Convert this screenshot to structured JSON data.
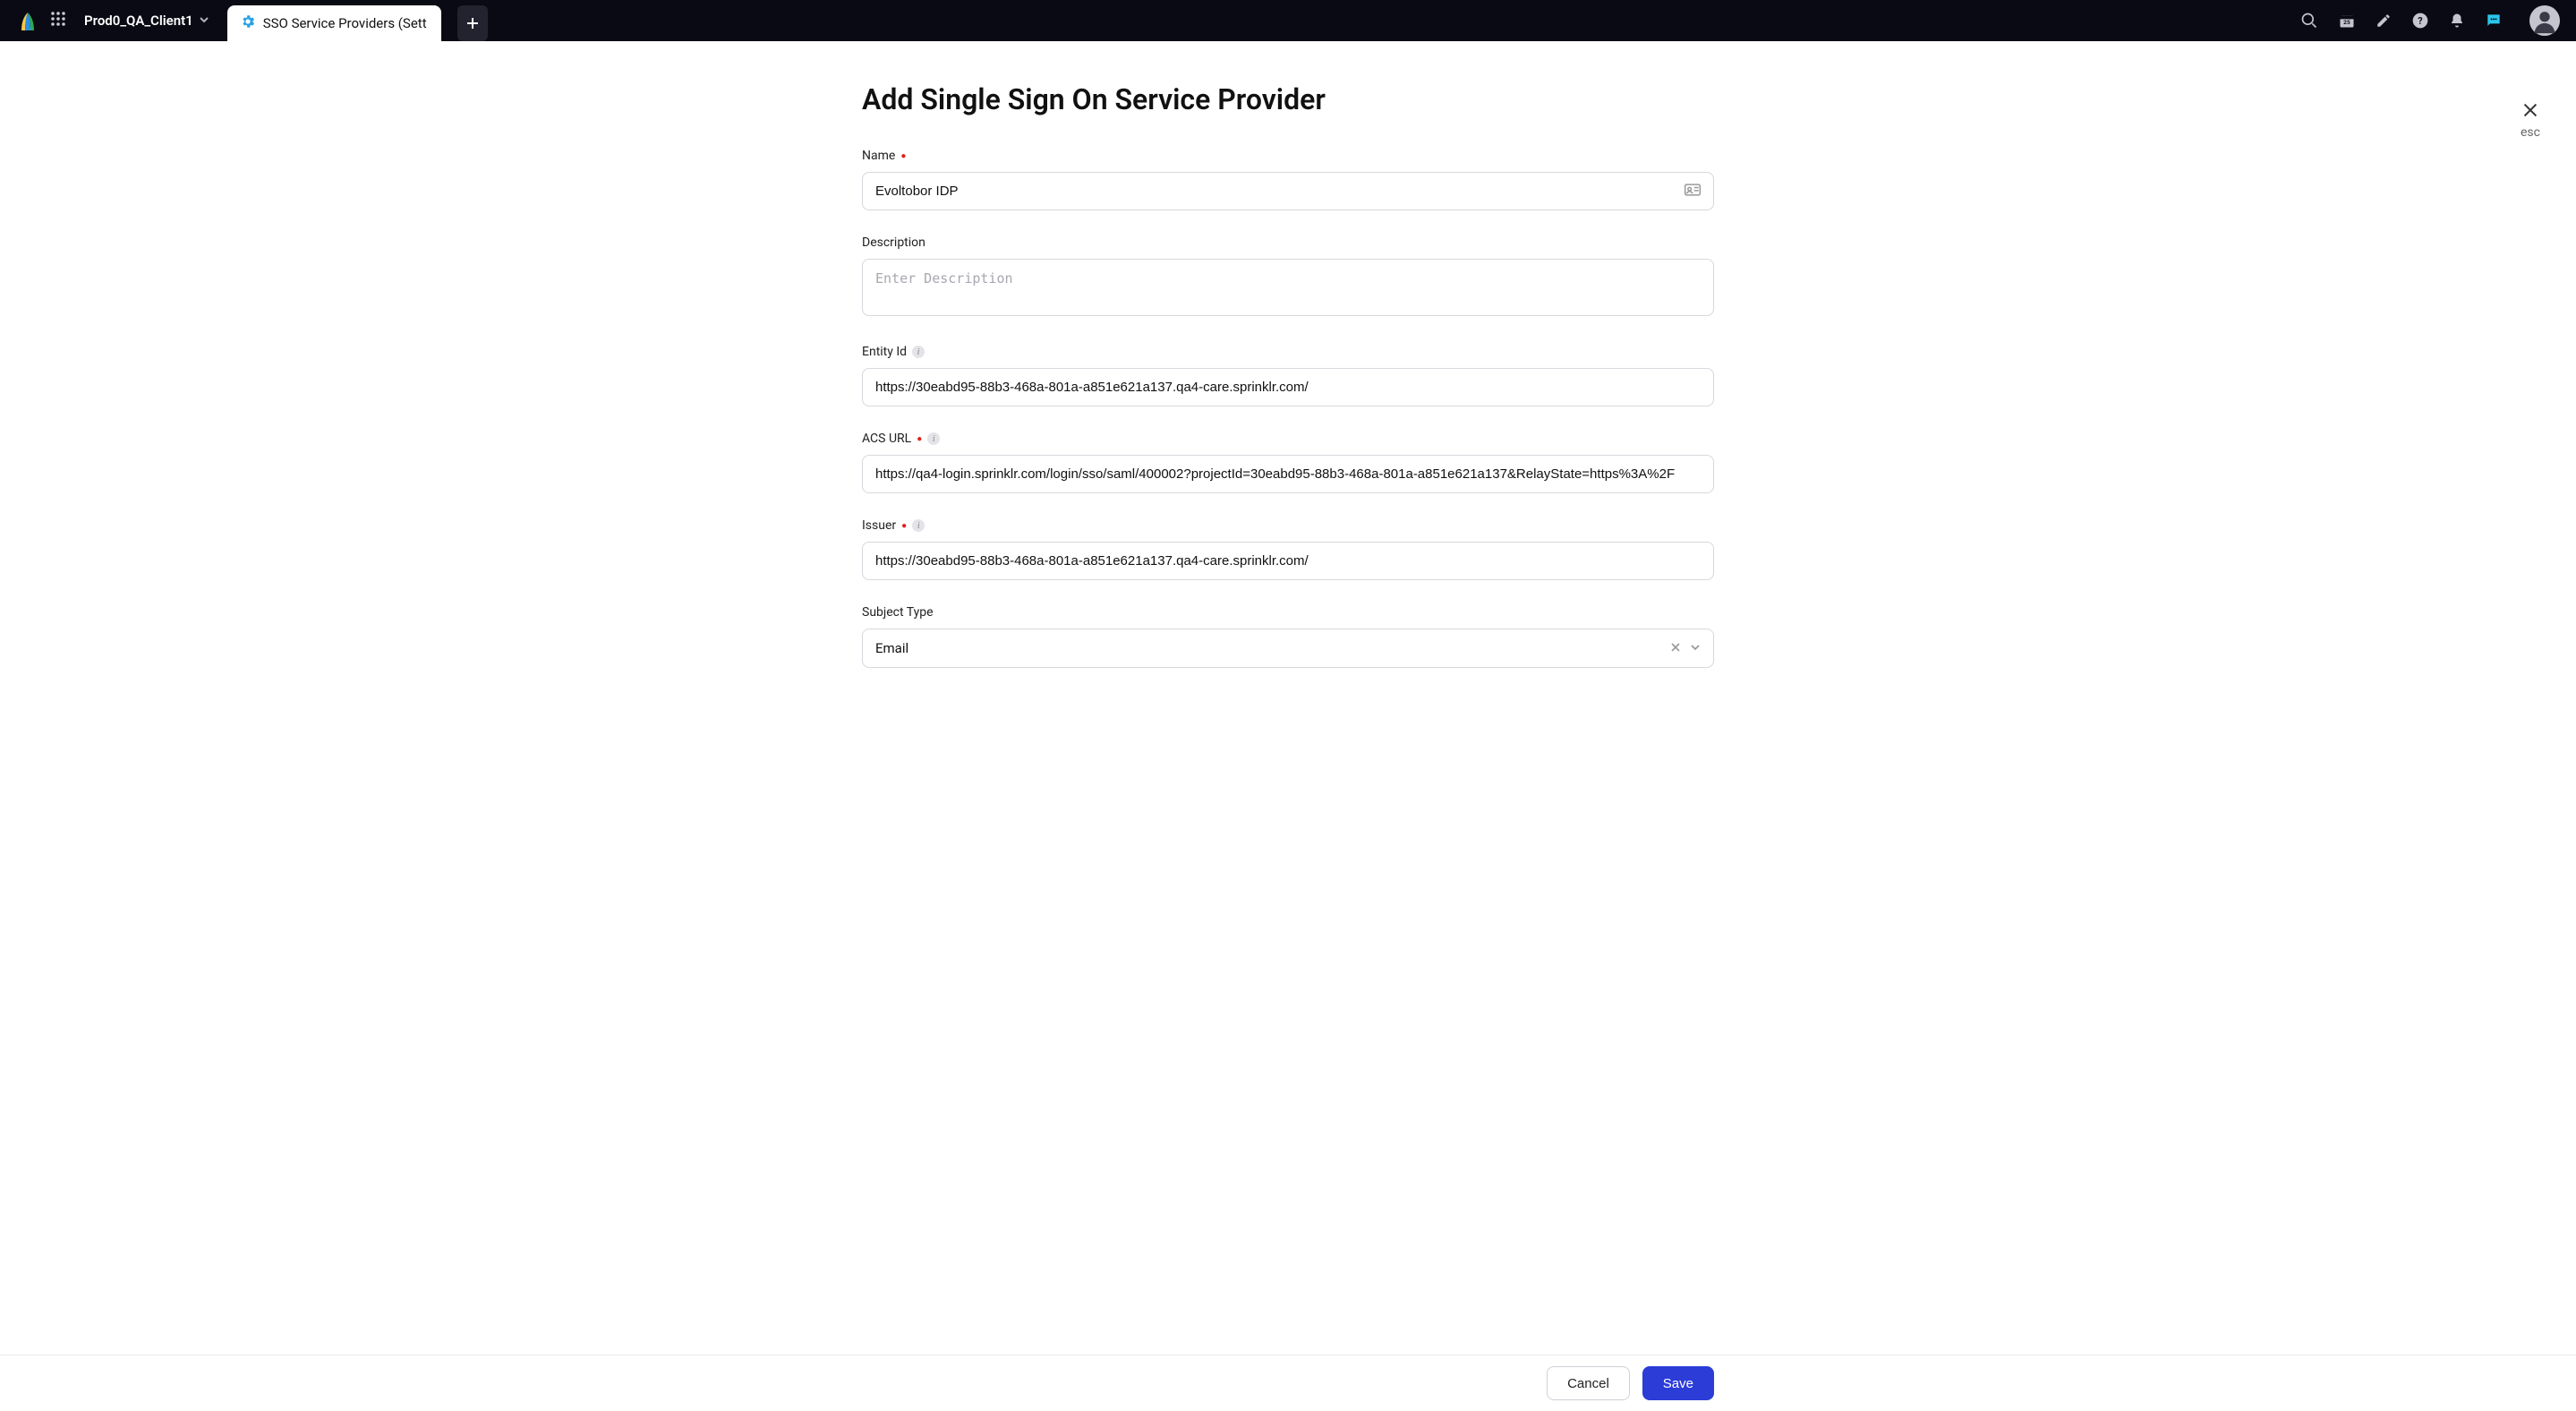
{
  "header": {
    "client_name": "Prod0_QA_Client1",
    "active_tab_label": "SSO Service Providers (Sett"
  },
  "close": {
    "esc_label": "esc"
  },
  "page": {
    "title": "Add Single Sign On Service Provider"
  },
  "form": {
    "name": {
      "label": "Name",
      "value": "Evoltobor IDP"
    },
    "description": {
      "label": "Description",
      "placeholder": "Enter Description",
      "value": ""
    },
    "entity_id": {
      "label": "Entity Id",
      "value": "https://30eabd95-88b3-468a-801a-a851e621a137.qa4-care.sprinklr.com/"
    },
    "acs_url": {
      "label": "ACS URL",
      "value": "https://qa4-login.sprinklr.com/login/sso/saml/400002?projectId=30eabd95-88b3-468a-801a-a851e621a137&RelayState=https%3A%2F"
    },
    "issuer": {
      "label": "Issuer",
      "value": "https://30eabd95-88b3-468a-801a-a851e621a137.qa4-care.sprinklr.com/"
    },
    "subject_type": {
      "label": "Subject Type",
      "value": "Email"
    }
  },
  "footer": {
    "cancel": "Cancel",
    "save": "Save"
  }
}
